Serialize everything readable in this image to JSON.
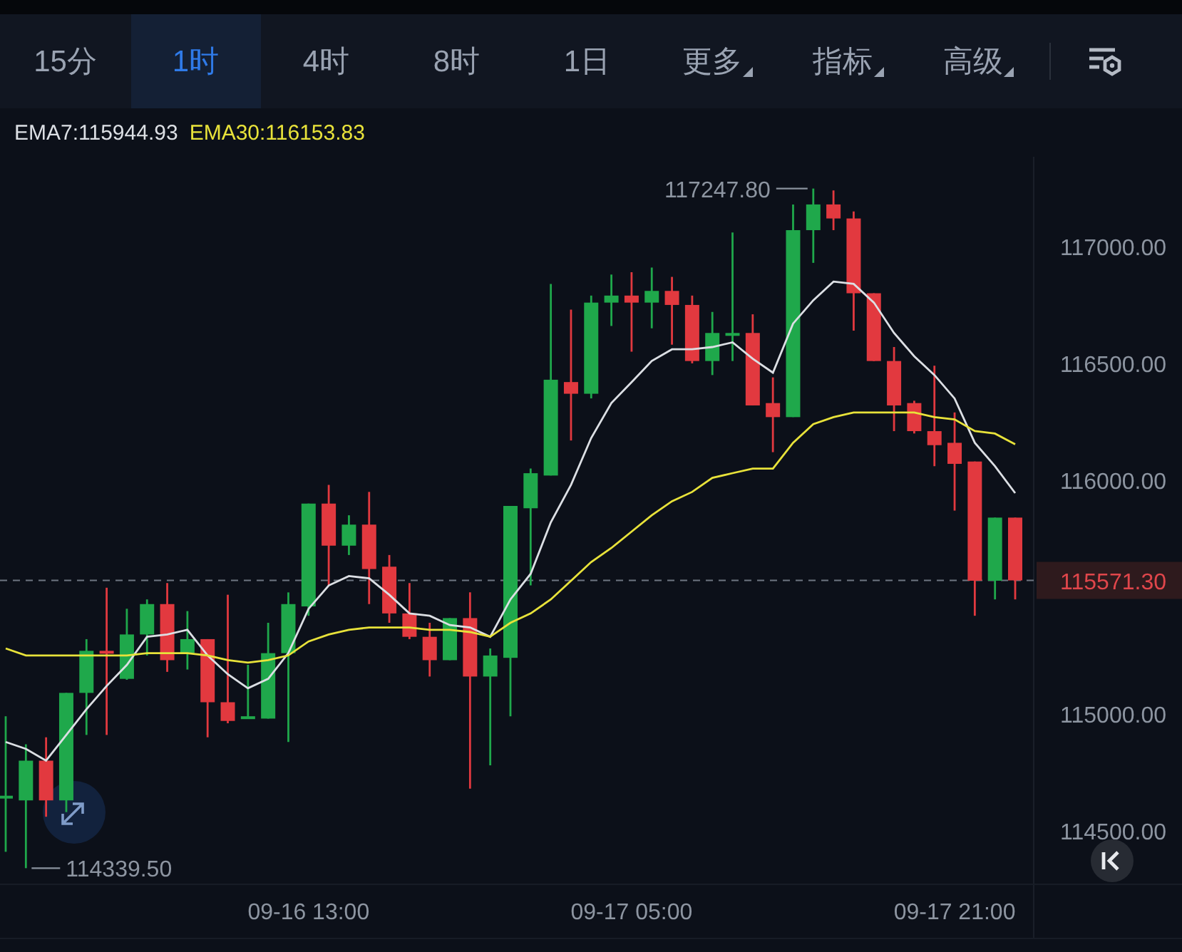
{
  "tabs": [
    {
      "kind": "tab",
      "label": "15分",
      "selected": false
    },
    {
      "kind": "tab",
      "label": "1时",
      "selected": true
    },
    {
      "kind": "tab",
      "label": "4时",
      "selected": false
    },
    {
      "kind": "tab",
      "label": "8时",
      "selected": false
    },
    {
      "kind": "tab",
      "label": "1日",
      "selected": false
    },
    {
      "kind": "dropdown",
      "label": "更多",
      "selected": false
    },
    {
      "kind": "dropdown",
      "label": "指标",
      "selected": false
    },
    {
      "kind": "dropdown",
      "label": "高级",
      "selected": false
    }
  ],
  "chart": {
    "chart_data": {
      "type": "candlestick",
      "ylim": [
        114274,
        117384
      ],
      "yticks": [
        {
          "value": 114500,
          "label": "114500.00"
        },
        {
          "value": 115000,
          "label": "115000.00"
        },
        {
          "value": 116000,
          "label": "116000.00"
        },
        {
          "value": 116500,
          "label": "116500.00"
        },
        {
          "value": 117000,
          "label": "117000.00"
        }
      ],
      "categories": [
        null,
        null,
        null,
        null,
        null,
        null,
        null,
        null,
        null,
        null,
        null,
        null,
        null,
        null,
        null,
        "09-16 13:00",
        null,
        null,
        null,
        null,
        null,
        null,
        null,
        null,
        null,
        null,
        null,
        null,
        null,
        null,
        null,
        "09-17 05:00",
        null,
        null,
        null,
        null,
        null,
        null,
        null,
        null,
        null,
        null,
        null,
        null,
        null,
        null,
        null,
        "09-17 21:00",
        null,
        null,
        null
      ],
      "series": [
        {
          "name": "EMA7:115944.93",
          "type": "line",
          "color": "#dcdfe4",
          "values": [
            114880,
            114850,
            114800,
            114910,
            115020,
            115120,
            115210,
            115330,
            115340,
            115360,
            115250,
            115170,
            115110,
            115150,
            115260,
            115450,
            115550,
            115590,
            115580,
            115510,
            115430,
            115420,
            115380,
            115370,
            115330,
            115490,
            115600,
            115820,
            115980,
            116180,
            116330,
            116420,
            116510,
            116560,
            116560,
            116570,
            116590,
            116520,
            116460,
            116670,
            116770,
            116850,
            116840,
            116760,
            116630,
            116530,
            116450,
            116350,
            116160,
            116060,
            115945
          ]
        },
        {
          "name": "EMA30:116153.83",
          "type": "line",
          "color": "#e8e23a",
          "values": [
            115280,
            115250,
            115250,
            115250,
            115250,
            115250,
            115250,
            115260,
            115260,
            115260,
            115250,
            115230,
            115220,
            115230,
            115250,
            115310,
            115340,
            115360,
            115370,
            115370,
            115370,
            115360,
            115360,
            115350,
            115330,
            115390,
            115430,
            115490,
            115570,
            115650,
            115710,
            115780,
            115850,
            115910,
            115950,
            116010,
            116030,
            116050,
            116050,
            116160,
            116240,
            116270,
            116290,
            116290,
            116290,
            116290,
            116270,
            116260,
            116210,
            116200,
            116154
          ]
        }
      ],
      "ohlc": [
        [
          114640,
          114990,
          114410,
          114650
        ],
        [
          114630,
          114870,
          114340,
          114800
        ],
        [
          114800,
          114900,
          114560,
          114630
        ],
        [
          114630,
          115090,
          114580,
          115090
        ],
        [
          115090,
          115320,
          114910,
          115270
        ],
        [
          115270,
          115540,
          114910,
          115260
        ],
        [
          115150,
          115450,
          115146,
          115340
        ],
        [
          115340,
          115490,
          115250,
          115470
        ],
        [
          115470,
          115560,
          115180,
          115230
        ],
        [
          115260,
          115440,
          115190,
          115320
        ],
        [
          115320,
          115320,
          114900,
          115050
        ],
        [
          115050,
          115510,
          114960,
          114970
        ],
        [
          114980,
          115210,
          114980,
          114990
        ],
        [
          114980,
          115390,
          114980,
          115260
        ],
        [
          115260,
          115520,
          114880,
          115470
        ],
        [
          115460,
          115900,
          115420,
          115900
        ],
        [
          115900,
          115980,
          115550,
          115720
        ],
        [
          115720,
          115850,
          115680,
          115810
        ],
        [
          115810,
          115950,
          115470,
          115620
        ],
        [
          115630,
          115680,
          115390,
          115430
        ],
        [
          115430,
          115560,
          115320,
          115330
        ],
        [
          115330,
          115390,
          115160,
          115230
        ],
        [
          115230,
          115410,
          115230,
          115410
        ],
        [
          115410,
          115520,
          114680,
          115160
        ],
        [
          115160,
          115280,
          114780,
          115250
        ],
        [
          115240,
          115890,
          114990,
          115890
        ],
        [
          115880,
          116050,
          115550,
          116030
        ],
        [
          116020,
          116840,
          116020,
          116430
        ],
        [
          116420,
          116730,
          116170,
          116370
        ],
        [
          116370,
          116790,
          116350,
          116760
        ],
        [
          116760,
          116880,
          116660,
          116790
        ],
        [
          116790,
          116890,
          116550,
          116760
        ],
        [
          116760,
          116910,
          116650,
          116810
        ],
        [
          116810,
          116870,
          116580,
          116750
        ],
        [
          116750,
          116790,
          116500,
          116510
        ],
        [
          116510,
          116720,
          116450,
          116630
        ],
        [
          116620,
          117060,
          116510,
          116630
        ],
        [
          116630,
          116710,
          116320,
          116320
        ],
        [
          116330,
          116440,
          116120,
          116270
        ],
        [
          116270,
          117180,
          116270,
          117070
        ],
        [
          117070,
          117248,
          116930,
          117180
        ],
        [
          117180,
          117240,
          117070,
          117120
        ],
        [
          117120,
          117150,
          116640,
          116800
        ],
        [
          116800,
          116800,
          116510,
          116510
        ],
        [
          116510,
          116570,
          116210,
          116320
        ],
        [
          116330,
          116340,
          116200,
          116210
        ],
        [
          116210,
          116490,
          116060,
          116150
        ],
        [
          116160,
          116290,
          115870,
          116070
        ],
        [
          116080,
          116080,
          115420,
          115570
        ],
        [
          115570,
          115840,
          115490,
          115840
        ],
        [
          115840,
          115840,
          115490,
          115571.3
        ]
      ],
      "annotations": [
        "117247.80",
        "114339.50"
      ],
      "ref_lines": [
        {
          "axis": "y",
          "value": 115571.3,
          "label": "115571.30"
        }
      ]
    }
  }
}
